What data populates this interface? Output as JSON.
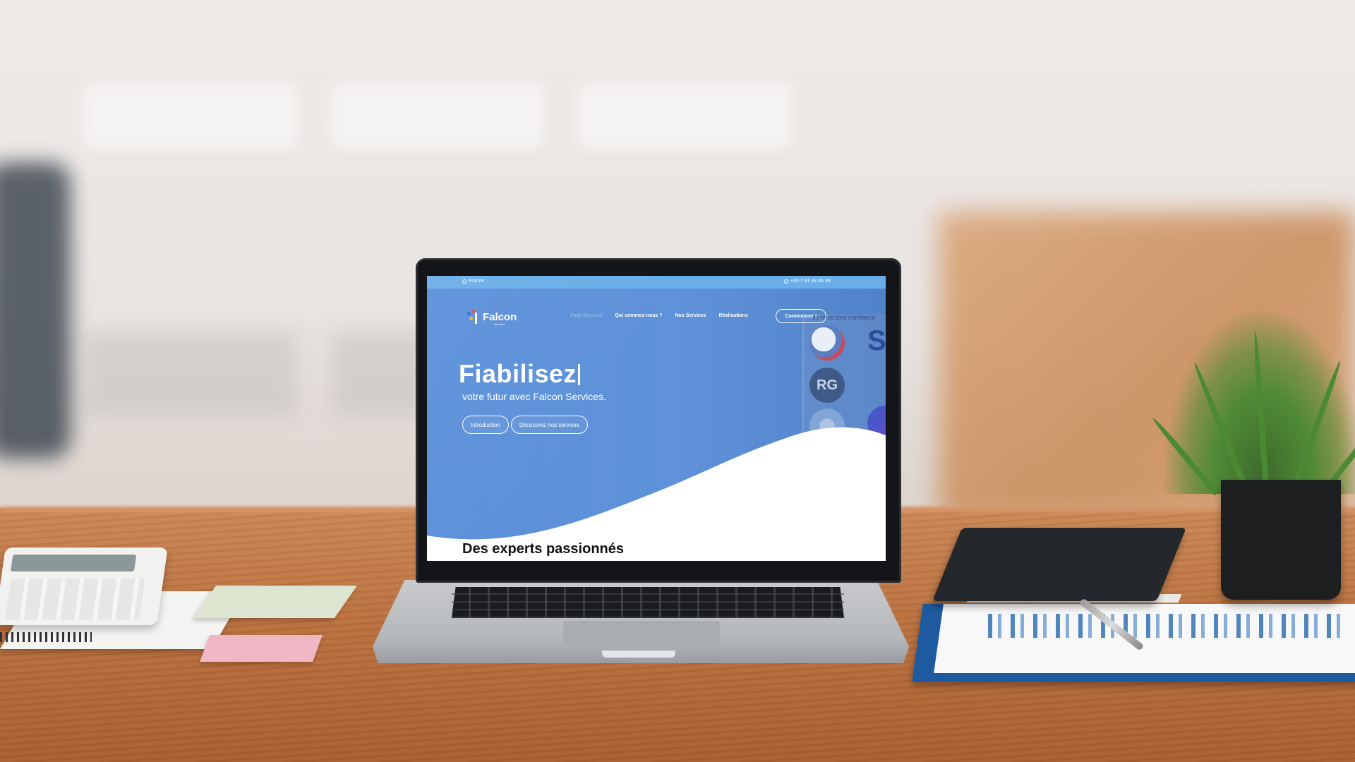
{
  "topbar": {
    "country": "France",
    "phone": "+33 7 81 33 36 38"
  },
  "brand": {
    "name": "Falcon",
    "sub": "Services",
    "colors": {
      "hero_blue": "#5a90da",
      "topbar_blue": "#6aaee8",
      "accent_red": "#e8463c",
      "accent_yellow": "#f2b632",
      "accent_green": "#4cb050",
      "accent_blue": "#2a6fd6"
    }
  },
  "nav": {
    "items": [
      {
        "label": "Page d'accueil",
        "active": true
      },
      {
        "label": "Qui sommes-nous ?",
        "active": false
      },
      {
        "label": "Nos Services",
        "active": false
      },
      {
        "label": "Réalisations",
        "active": false
      }
    ],
    "cta_label": "Commencer !"
  },
  "side_panel": {
    "title": "Ils nous font confiance",
    "badge_text": "RG",
    "letter_logo": "S"
  },
  "hero": {
    "headline": "Fiabilisez",
    "subline": "votre futur avec Falcon Services.",
    "buttons": [
      "Introduction",
      "Découvrez nos services"
    ]
  },
  "section": {
    "title": "Des experts passionnés"
  },
  "icons": {
    "country": "home-icon",
    "phone": "whatsapp-icon"
  }
}
